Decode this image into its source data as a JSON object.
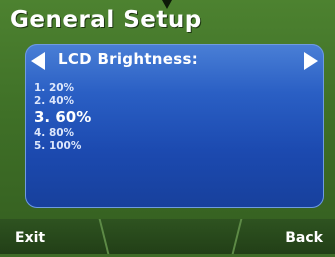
{
  "header": {
    "title": "General Setup"
  },
  "setting": {
    "label": "LCD Brightness:"
  },
  "options": [
    {
      "label": "1.  20%",
      "selected": false
    },
    {
      "label": "2.  40%",
      "selected": false
    },
    {
      "label": "3. 60%",
      "selected": true
    },
    {
      "label": "4.  80%",
      "selected": false
    },
    {
      "label": "5.  100%",
      "selected": false
    }
  ],
  "softkeys": {
    "left": "Exit",
    "middle": "",
    "right": "Back"
  },
  "icons": {
    "top": "pointer-down-icon",
    "prev": "arrow-left-icon",
    "next": "arrow-right-icon"
  },
  "colors": {
    "background": "#3f6b28",
    "panel": "#2a5fc4",
    "text": "#ffffff"
  }
}
